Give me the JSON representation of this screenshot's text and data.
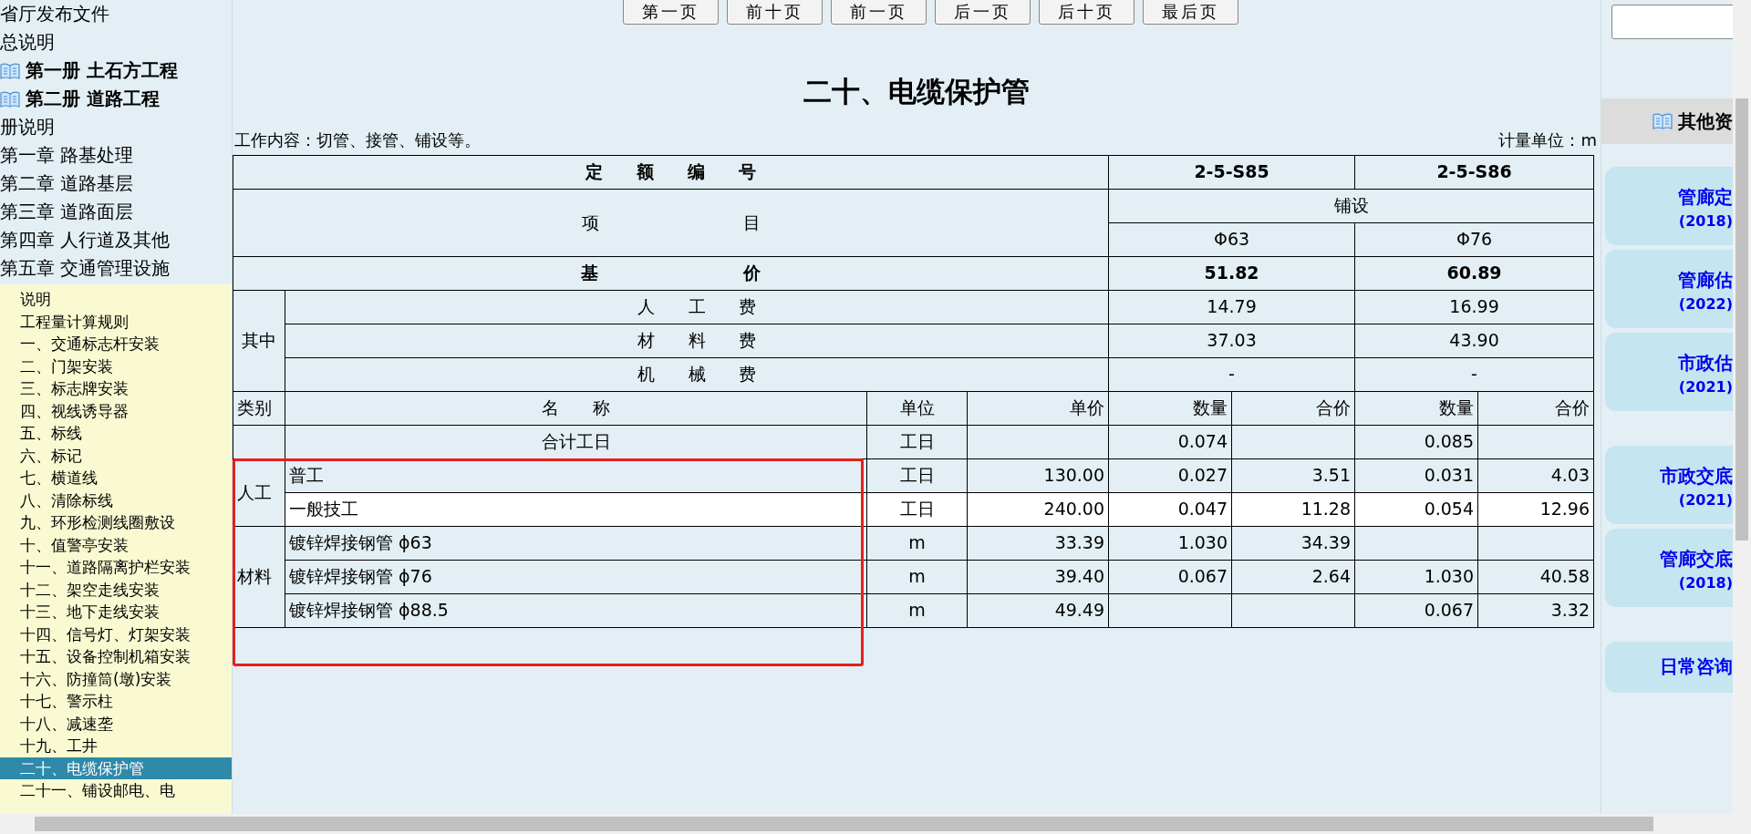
{
  "sidebar": {
    "top_items": [
      {
        "label": "省厅发布文件",
        "kind": "plain"
      },
      {
        "label": "总说明",
        "kind": "plain"
      },
      {
        "label": "第一册 土石方工程",
        "kind": "book"
      },
      {
        "label": "第二册 道路工程",
        "kind": "book"
      },
      {
        "label": "册说明",
        "kind": "plain"
      },
      {
        "label": "第一章 路基处理",
        "kind": "plain"
      },
      {
        "label": "第二章 道路基层",
        "kind": "plain"
      },
      {
        "label": "第三章 道路面层",
        "kind": "plain"
      },
      {
        "label": "第四章 人行道及其他",
        "kind": "plain"
      },
      {
        "label": "第五章 交通管理设施",
        "kind": "plain"
      }
    ],
    "section_items": [
      {
        "label": "说明",
        "selected": false
      },
      {
        "label": "工程量计算规则",
        "selected": false
      },
      {
        "label": "一、交通标志杆安装",
        "selected": false
      },
      {
        "label": "二、门架安装",
        "selected": false
      },
      {
        "label": "三、标志牌安装",
        "selected": false
      },
      {
        "label": "四、视线诱导器",
        "selected": false
      },
      {
        "label": "五、标线",
        "selected": false
      },
      {
        "label": "六、标记",
        "selected": false
      },
      {
        "label": "七、横道线",
        "selected": false
      },
      {
        "label": "八、清除标线",
        "selected": false
      },
      {
        "label": "九、环形检测线圈敷设",
        "selected": false
      },
      {
        "label": "十、值警亭安装",
        "selected": false
      },
      {
        "label": "十一、道路隔离护栏安装",
        "selected": false
      },
      {
        "label": "十二、架空走线安装",
        "selected": false
      },
      {
        "label": "十三、地下走线安装",
        "selected": false
      },
      {
        "label": "十四、信号灯、灯架安装",
        "selected": false
      },
      {
        "label": "十五、设备控制机箱安装",
        "selected": false
      },
      {
        "label": "十六、防撞筒(墩)安装",
        "selected": false
      },
      {
        "label": "十七、警示柱",
        "selected": false
      },
      {
        "label": "十八、减速垄",
        "selected": false
      },
      {
        "label": "十九、工井",
        "selected": false
      },
      {
        "label": "二十、电缆保护管",
        "selected": true
      },
      {
        "label": "二十一、铺设邮电、电",
        "selected": false
      }
    ]
  },
  "pager": {
    "buttons": [
      "第一页",
      "前十页",
      "前一页",
      "后一页",
      "后十页",
      "最后页"
    ]
  },
  "title": "二十、电缆保护管",
  "work_content": "工作内容：切管、接管、铺设等。",
  "unit_label": "计量单位：m",
  "quota_table": {
    "code_row": {
      "label": "定 额 编 号",
      "values": [
        "2-5-S85",
        "2-5-S86"
      ]
    },
    "item_row": {
      "label": "项 目",
      "group": "铺设",
      "values": [
        "Φ63",
        "Φ76"
      ]
    },
    "base_row": {
      "label": "基 价",
      "values": [
        "51.82",
        "60.89"
      ]
    },
    "breakdown": {
      "label": "其中",
      "rows": [
        {
          "label": "人 工 费",
          "values": [
            "14.79",
            "16.99"
          ]
        },
        {
          "label": "材 料 费",
          "values": [
            "37.03",
            "43.90"
          ]
        },
        {
          "label": "机 械 费",
          "values": [
            "-",
            "-"
          ]
        }
      ]
    },
    "columns": [
      "类别",
      "名 称",
      "单位",
      "单价",
      "数量",
      "合价",
      "数量",
      "合价"
    ],
    "summary_row": {
      "name": "合计工日",
      "unit": "工日",
      "qty_1": "0.074",
      "qty_2": "0.085"
    },
    "groups": [
      {
        "category": "人工",
        "rows": [
          {
            "name": "普工",
            "unit": "工日",
            "price": "130.00",
            "qty_1": "0.027",
            "total_1": "3.51",
            "qty_2": "0.031",
            "total_2": "4.03",
            "highlighted": false
          },
          {
            "name": "一般技工",
            "unit": "工日",
            "price": "240.00",
            "qty_1": "0.047",
            "total_1": "11.28",
            "qty_2": "0.054",
            "total_2": "12.96",
            "highlighted": true
          }
        ]
      },
      {
        "category": "材料",
        "rows": [
          {
            "name": "镀锌焊接钢管 ϕ63",
            "unit": "m",
            "price": "33.39",
            "qty_1": "1.030",
            "total_1": "34.39",
            "highlighted": false
          },
          {
            "name": "镀锌焊接钢管 ϕ76",
            "unit": "m",
            "price": "39.40",
            "qty_1": "0.067",
            "total_1": "2.64",
            "qty_2": "1.030",
            "total_2": "40.58",
            "highlighted": false
          },
          {
            "name": "镀锌焊接钢管 ϕ88.5",
            "unit": "m",
            "price": "49.49",
            "qty_2": "0.067",
            "total_2": "3.32",
            "highlighted": false
          }
        ]
      }
    ]
  },
  "right_panel": {
    "header": "其他资",
    "links": [
      {
        "title": "管廊定",
        "year": "(2018)"
      },
      {
        "title": "管廊估",
        "year": "(2022)"
      },
      {
        "title": "市政估",
        "year": "(2021)"
      },
      {
        "title": "市政交底",
        "year": "(2021)"
      },
      {
        "title": "管廊交底",
        "year": "(2018)"
      },
      {
        "title": "日常咨询"
      }
    ]
  }
}
